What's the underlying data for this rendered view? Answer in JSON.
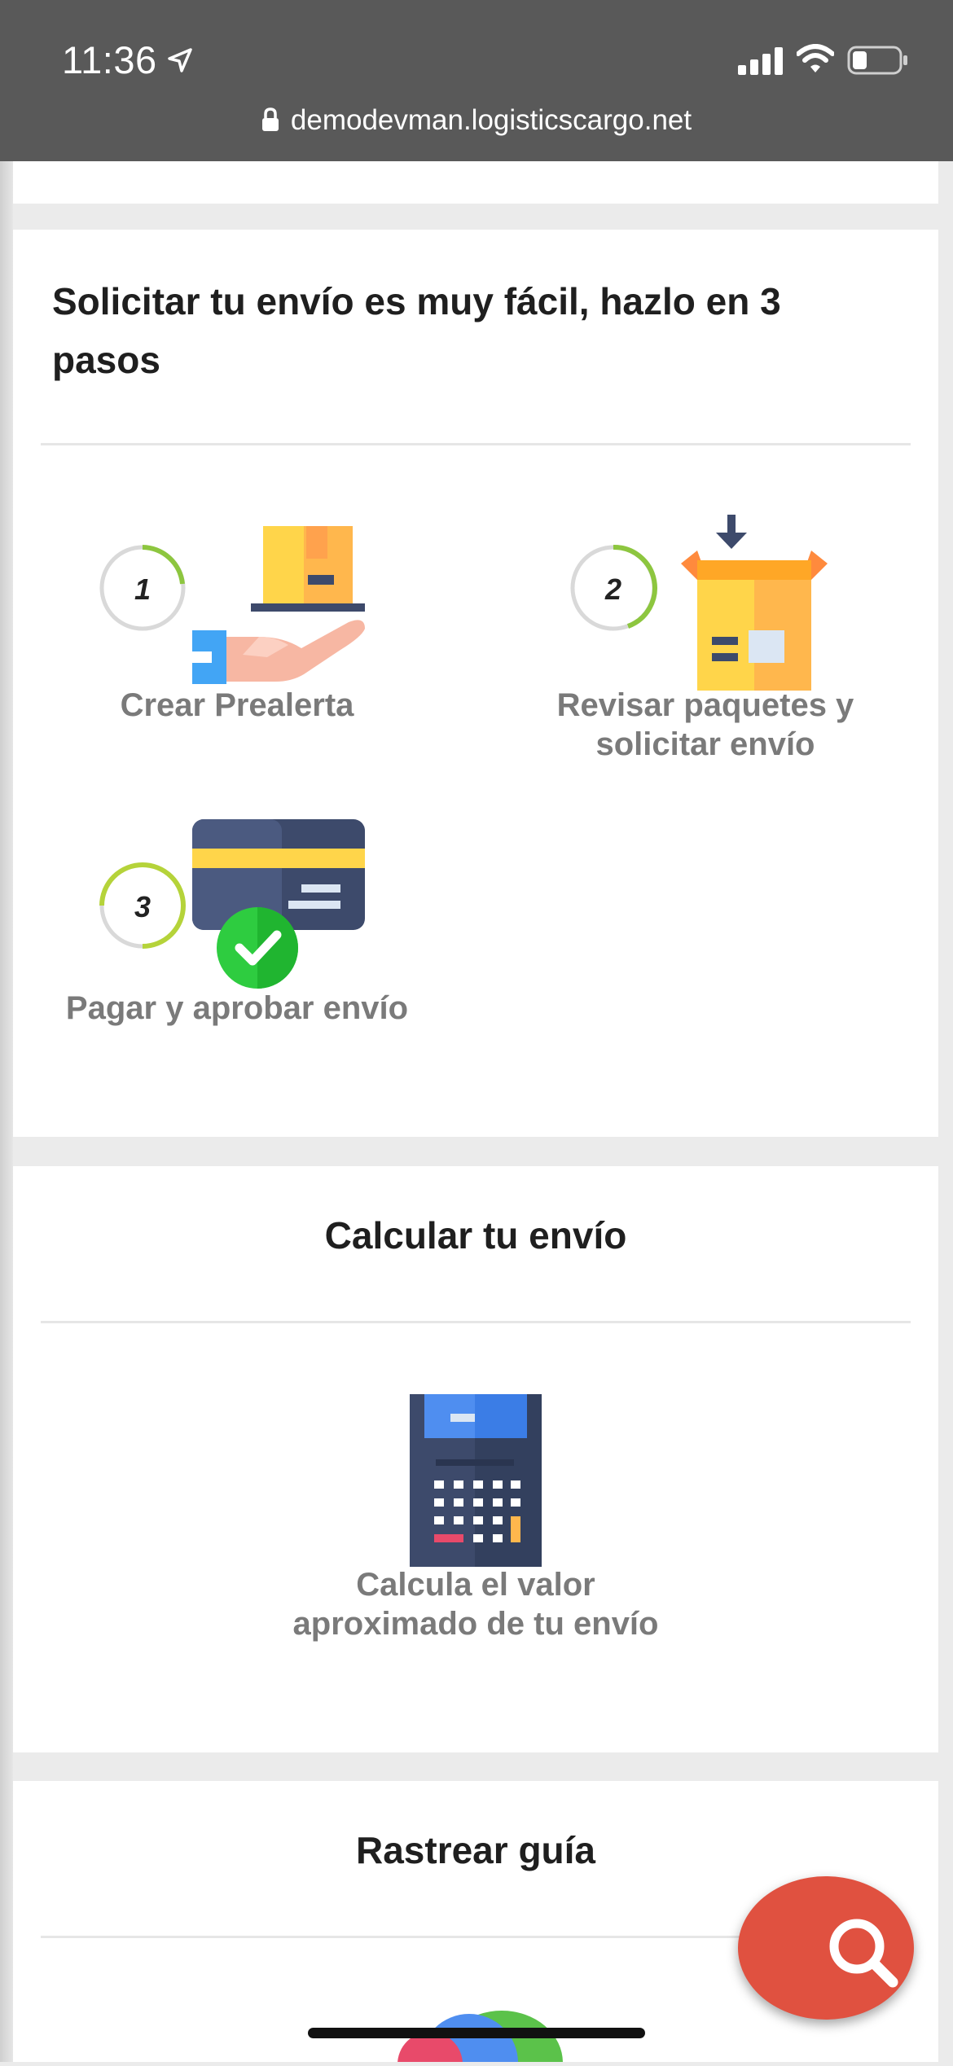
{
  "status_bar": {
    "time": "11:36",
    "url": "demodevman.logisticscargo.net"
  },
  "steps_section": {
    "title": "Solicitar tu envío es muy fácil, hazlo en 3 pasos",
    "steps": [
      {
        "number": "1",
        "label": "Crear Prealerta",
        "icon": "package-hand-icon"
      },
      {
        "number": "2",
        "label": "Revisar paquetes y solicitar envío",
        "icon": "open-box-icon"
      },
      {
        "number": "3",
        "label": "Pagar y aprobar envío",
        "icon": "credit-card-check-icon"
      }
    ]
  },
  "calc_section": {
    "title": "Calcular tu envío",
    "label": "Calcula el valor aproximado de tu envío",
    "icon": "calculator-icon"
  },
  "track_section": {
    "title": "Rastrear guía"
  },
  "fab": {
    "icon": "search-icon"
  },
  "colors": {
    "status_bar": "#595959",
    "fab": "#e05140",
    "step_label": "#7a7a7a"
  }
}
